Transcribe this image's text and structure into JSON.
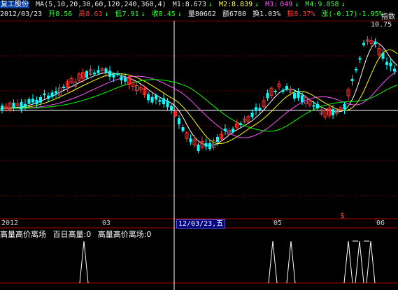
{
  "info_bar": {
    "stock_name": "复工股份",
    "ma_params": "MA(5,10,20,30,60,120,240,360,4)",
    "m1": "M1:8.673",
    "m2": "M2:8.839",
    "m3": "M3:",
    "m3_value": "049",
    "m4": "M4:9.058",
    "date": "2012/03/23",
    "open": "开8.56",
    "high": "高8.63",
    "low": "低7.91",
    "close": "收8.45",
    "volume": "量80662",
    "amount": "额6780",
    "turnover": "换1.03%",
    "amplitude": "振8.37%",
    "change": "涨(-0.17)-1.95%",
    "right_cut": "指数"
  },
  "price_tag": "10.75",
  "time_axis": {
    "labels": [
      "2012",
      "03",
      "05",
      "06"
    ],
    "cursor_date": "12/03/23,五"
  },
  "indicator": {
    "title": "高量高价离场",
    "item1": "百日高量:0",
    "item2": "高量高价离场:0"
  },
  "colors": {
    "up": "#ff3232",
    "down": "#00ffff",
    "ma5": "#ffffff",
    "ma10": "#ffff00",
    "ma20": "#ff55ff",
    "ma30": "#00ff00"
  }
}
